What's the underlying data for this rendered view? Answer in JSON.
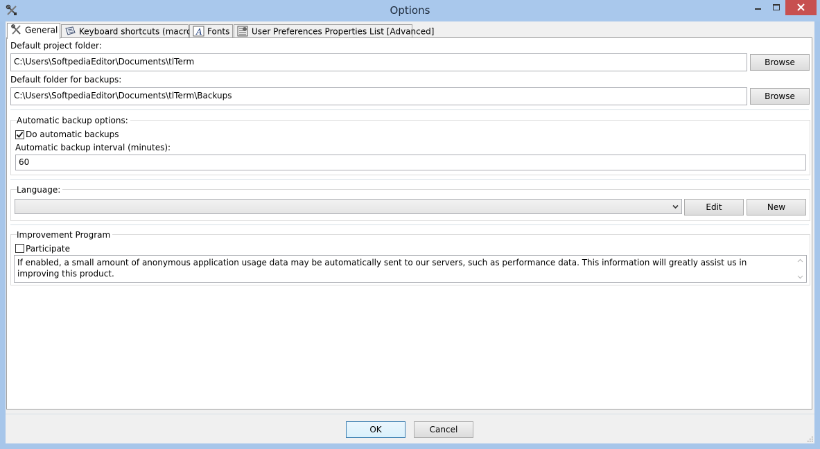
{
  "window": {
    "title": "Options"
  },
  "tabs": [
    {
      "label": "General",
      "icon": "tools-icon"
    },
    {
      "label": "Keyboard shortcuts (macros)",
      "icon": "keyboard-icon"
    },
    {
      "label": "Fonts",
      "icon": "font-icon"
    },
    {
      "label": "User Preferences Properties List [Advanced]",
      "icon": "properties-icon"
    }
  ],
  "general": {
    "project_folder_label": "Default project folder:",
    "project_folder_value": "C:\\Users\\SoftpediaEditor\\Documents\\tlTerm",
    "backup_folder_label": "Default folder for backups:",
    "backup_folder_value": "C:\\Users\\SoftpediaEditor\\Documents\\tlTerm\\Backups",
    "browse_label": "Browse",
    "auto_backup": {
      "group_label": "Automatic backup options:",
      "do_backups_label": "Do automatic backups",
      "do_backups_checked": true,
      "interval_label": "Automatic backup interval (minutes):",
      "interval_value": "60"
    },
    "language": {
      "group_label": "Language:",
      "selected": "",
      "edit_label": "Edit",
      "new_label": "New"
    },
    "improvement": {
      "group_label": "Improvement Program",
      "participate_label": "Participate",
      "participate_checked": false,
      "description": "If enabled, a small amount of anonymous application usage data may be automatically sent to our servers, such as performance data. This information will greatly assist us in improving this product."
    }
  },
  "footer": {
    "ok_label": "OK",
    "cancel_label": "Cancel"
  }
}
